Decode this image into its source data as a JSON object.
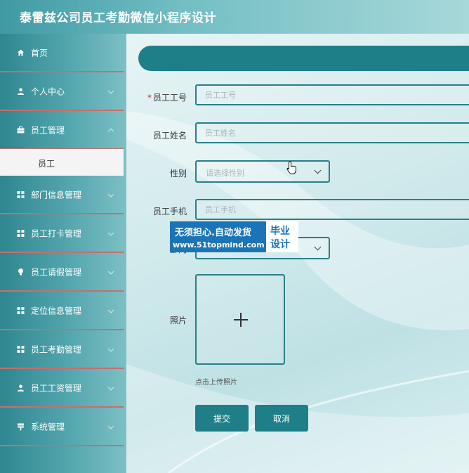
{
  "app": {
    "title": "泰雷兹公司员工考勤微信小程序设计"
  },
  "sidebar": {
    "items": [
      {
        "label": "首页",
        "icon": "home-icon",
        "chevron": false
      },
      {
        "label": "个人中心",
        "icon": "user-icon",
        "chevron": true
      },
      {
        "label": "员工管理",
        "icon": "briefcase-icon",
        "chevron": true
      },
      {
        "label": "部门信息管理",
        "icon": "grid-icon",
        "chevron": true
      },
      {
        "label": "员工打卡管理",
        "icon": "grid-icon",
        "chevron": true
      },
      {
        "label": "员工请假管理",
        "icon": "bulb-icon",
        "chevron": true
      },
      {
        "label": "定位信息管理",
        "icon": "grid-icon",
        "chevron": true
      },
      {
        "label": "员工考勤管理",
        "icon": "grid-icon",
        "chevron": true
      },
      {
        "label": "员工工资管理",
        "icon": "user-icon",
        "chevron": true
      },
      {
        "label": "系统管理",
        "icon": "sign-icon",
        "chevron": true
      }
    ],
    "submenu": {
      "label": "员工"
    }
  },
  "form": {
    "employee_no": {
      "label": "员工工号",
      "required_mark": "*",
      "placeholder": "员工工号"
    },
    "employee_name": {
      "label": "员工姓名",
      "placeholder": "员工姓名"
    },
    "gender": {
      "label": "性别",
      "placeholder": "请选择性别"
    },
    "phone": {
      "label": "员工手机",
      "placeholder": "员工手机"
    },
    "department": {
      "label": "部门"
    },
    "photo": {
      "label": "照片",
      "hint": "点击上传照片"
    },
    "submit_label": "提交",
    "cancel_label": "取消"
  },
  "watermark": {
    "line1": "无须担心.自动发货",
    "line2": "www.51topmind.com",
    "box1": "毕业",
    "box2": "设计"
  },
  "colors": {
    "primary": "#1f7f88",
    "sidebar_divider": "#c46f6f",
    "watermark": "#1b74b8"
  }
}
